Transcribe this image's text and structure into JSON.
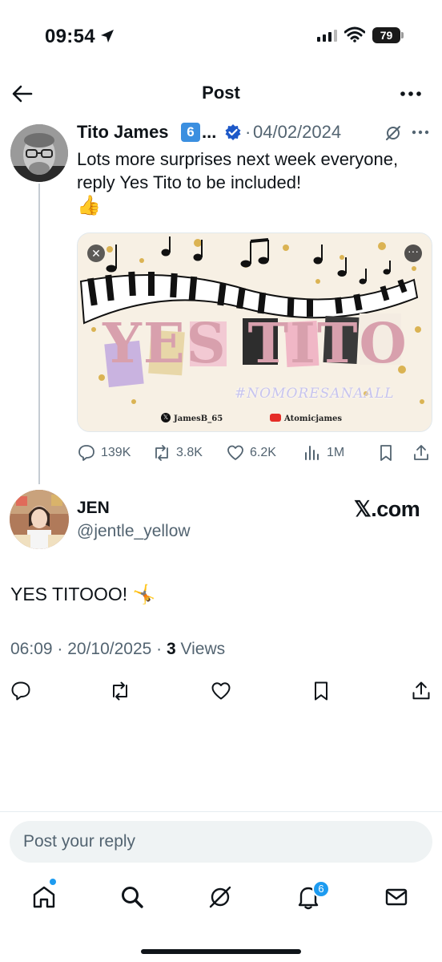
{
  "status_bar": {
    "time": "09:54",
    "battery_level": "79"
  },
  "header": {
    "title": "Post",
    "icons": [
      "back-arrow-icon",
      "more-icon"
    ]
  },
  "parent_post": {
    "author_name": "Tito James",
    "name_badge": "6",
    "name_ellipsis": "...",
    "verified": true,
    "separator": "·",
    "date": "04/02/2024",
    "text": "Lots more surprises next week everyone, reply Yes Tito to be included!",
    "emoji": "👍",
    "media": {
      "title_text": "YES TITO",
      "hashtag": "#NOMORESANAALL",
      "credit_x": "JamesB_65",
      "credit_youtube": "Atomicjames",
      "close_glyph": "✕",
      "more_glyph": "···"
    },
    "stats": {
      "replies": "139K",
      "reposts": "3.8K",
      "likes": "6.2K",
      "views": "1M"
    }
  },
  "reply_post": {
    "author_name": "JEN",
    "handle": "@jentle_yellow",
    "source_logo": "𝕏.com",
    "text": "YES TITOOO! 🤸",
    "time_date": "06:09 · 20/10/2025 · ",
    "view_count": "3",
    "views_label": " Views"
  },
  "composer": {
    "placeholder": "Post your reply"
  },
  "bottom_nav": {
    "items": [
      "home-icon",
      "search-icon",
      "grok-icon",
      "notifications-icon",
      "messages-icon"
    ],
    "notification_badge": "6"
  },
  "colors": {
    "accent": "#1d9bf0",
    "secondary_text": "#536471",
    "primary_text": "#0f1419",
    "verified": "#1d58c8"
  }
}
